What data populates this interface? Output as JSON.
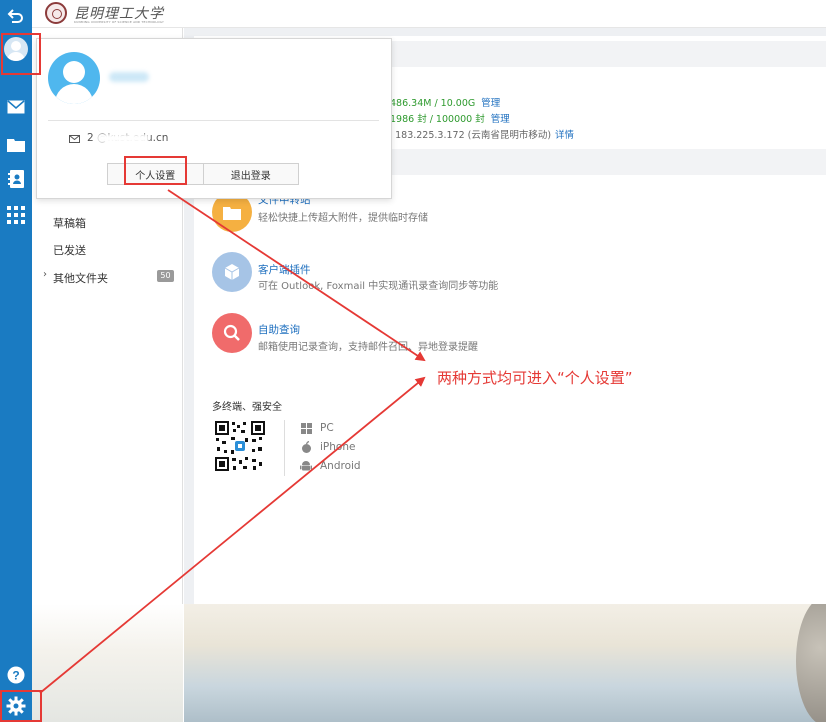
{
  "logo": {
    "name": "昆明理工大学",
    "subtitle": "KUNMING UNIVERSITY OF SCIENCE AND TECHNOLOGY"
  },
  "rail": {
    "icons": [
      "back-icon",
      "avatar-icon",
      "mail-icon",
      "folder-icon",
      "contacts-icon",
      "apps-grid-icon",
      "help-icon",
      "gear-icon"
    ]
  },
  "folders": {
    "drafts": "草稿箱",
    "sent": "已发送",
    "other": "其他文件夹",
    "other_count": "50"
  },
  "stats": {
    "capacity": "486.34M / 10.00G",
    "capacity_link": "管理",
    "letters": "1986 封 / 100000 封",
    "letters_link": "管理",
    "login": "43   183.225.3.172 (云南省昆明市移动)",
    "login_link": "详情"
  },
  "features": [
    {
      "title": "文件中转站",
      "desc": "轻松快捷上传超大附件，提供临时存储",
      "icon": "folder-icon",
      "color": "#f5b041"
    },
    {
      "title": "客户端插件",
      "desc": "可在 Outlook, Foxmail 中实现通讯录查询同步等功能",
      "icon": "cube-icon",
      "color": "#a6c4e6"
    },
    {
      "title": "自助查询",
      "desc": "邮箱使用记录查询，支持邮件召回、异地登录提醒",
      "icon": "search-icon",
      "color": "#f06b6b"
    }
  ],
  "multi": {
    "title": "多终端、强安全",
    "platforms": [
      {
        "label": "PC",
        "icon": "windows-icon"
      },
      {
        "label": "iPhone",
        "icon": "apple-icon"
      },
      {
        "label": "Android",
        "icon": "android-icon"
      }
    ]
  },
  "popup": {
    "email": "2        @kust.edu.cn",
    "settings_button": "个人设置",
    "logout_button": "退出登录"
  },
  "annotation": {
    "text": "两种方式均可进入“个人设置”",
    "color": "#e53935"
  }
}
